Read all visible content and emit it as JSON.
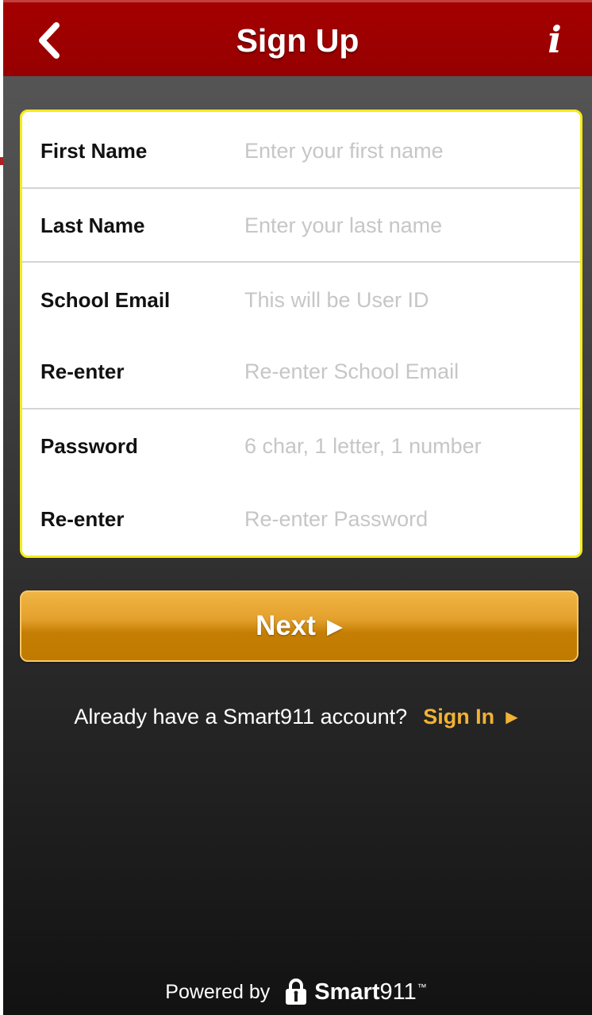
{
  "header": {
    "title": "Sign Up",
    "back_icon": "chevron-left-icon",
    "info_icon": "info-icon",
    "info_glyph": "i",
    "background_color": "#9c0000"
  },
  "form": {
    "border_color": "#f5ea1a",
    "fields": [
      {
        "label": "First Name",
        "placeholder": "Enter your first name",
        "value": ""
      },
      {
        "label": "Last Name",
        "placeholder": "Enter your last name",
        "value": ""
      },
      {
        "label": "School Email",
        "placeholder": "This will be User ID",
        "value": ""
      },
      {
        "label": "Re-enter",
        "placeholder": "Re-enter School Email",
        "value": ""
      },
      {
        "label": "Password",
        "placeholder": "6 char, 1 letter, 1 number",
        "value": ""
      },
      {
        "label": "Re-enter",
        "placeholder": "Re-enter Password",
        "value": ""
      }
    ]
  },
  "next_button": {
    "label": "Next",
    "arrow": "▶",
    "color": "#d08b10"
  },
  "signin": {
    "prompt": "Already have a Smart911 account?",
    "link_label": "Sign In",
    "arrow": "▶",
    "link_color": "#f2b233"
  },
  "footer": {
    "powered_by": "Powered by",
    "brand_bold": "Smart",
    "brand_light": "911",
    "brand_mark": "™",
    "logo_icon": "lock-icon"
  }
}
